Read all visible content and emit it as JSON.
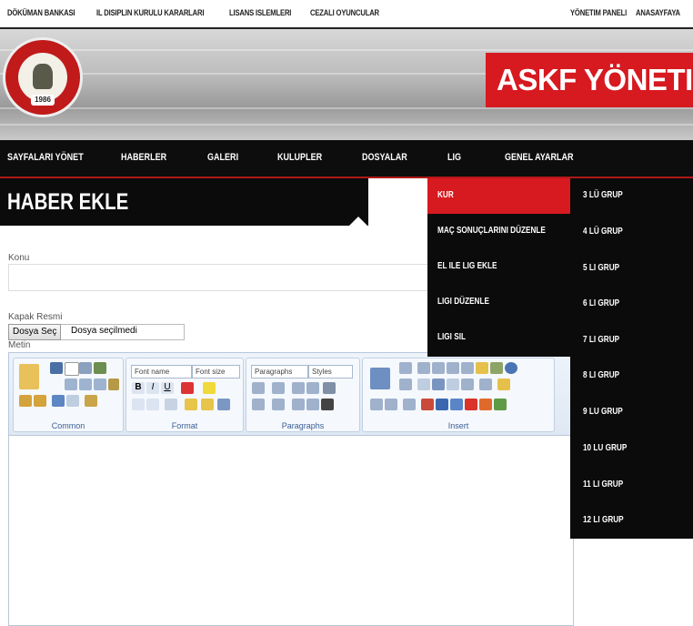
{
  "topnav": {
    "left": [
      "DÖKÜMAN BANKASI",
      "IL DISIPLIN KURULU KARARLARI",
      "LISANS ISLEMLERI",
      "CEZALI OYUNCULAR"
    ],
    "right": [
      "YÖNETIM PANELI",
      "ANASAYFAYA"
    ]
  },
  "banner": {
    "logo_year": "1986",
    "brand": "ASKF YÖNETIM PAN"
  },
  "mainnav": [
    "SAYFALARI YÖNET",
    "HABERLER",
    "GALERI",
    "KULUPLER",
    "DOSYALAR",
    "LIG",
    "GENEL AYARLAR"
  ],
  "page": {
    "title": "HABER EKLE"
  },
  "form": {
    "konu_label": "Konu",
    "konu_value": "",
    "kapak_label": "Kapak Resmi",
    "file_button": "Dosya Seç",
    "file_status": "Dosya seçilmedi",
    "metin_label": "Metin"
  },
  "editor": {
    "groups": [
      "Common",
      "Format",
      "Paragraphs",
      "Insert"
    ],
    "font_name": "Font name",
    "font_size": "Font size",
    "paragraphs": "Paragraphs",
    "styles": "Styles"
  },
  "lig_menu": [
    "KUR",
    "MAÇ SONUÇLARINI DÜZENLE",
    "EL ILE LIG EKLE",
    "LIGI DÜZENLE",
    "LIGI SIL"
  ],
  "kur_submenu": [
    "3 LÜ GRUP",
    "4 LÜ GRUP",
    "5 LI GRUP",
    "6 LI GRUP",
    "7 LI GRUP",
    "8 LI GRUP",
    "9 LU GRUP",
    "10 LU GRUP",
    "11 LI GRUP",
    "12 LI GRUP"
  ],
  "colors": {
    "accent": "#d71920",
    "nav_bg": "#0d0d0d"
  }
}
